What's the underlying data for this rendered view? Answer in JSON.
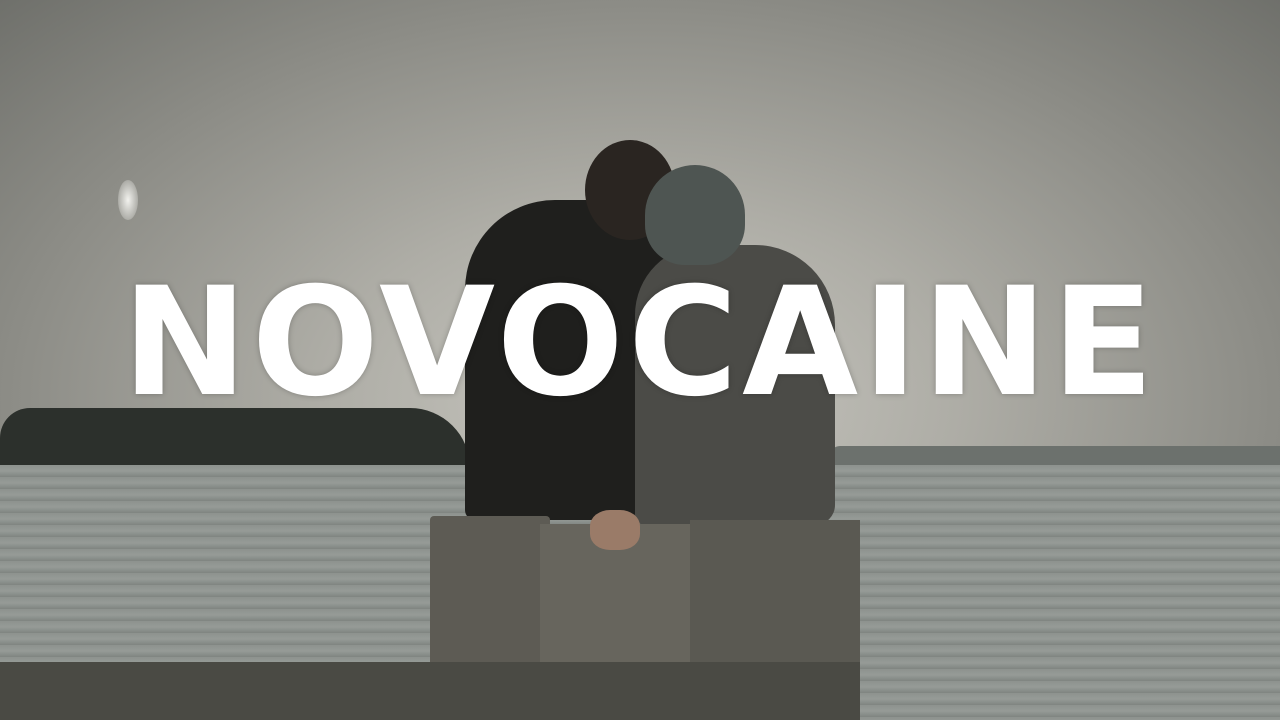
{
  "thumbnail": {
    "title": "NOVOCAINE"
  },
  "colors": {
    "title": "#ffffff",
    "sky": "#aeada6",
    "water": "#8d928e"
  }
}
